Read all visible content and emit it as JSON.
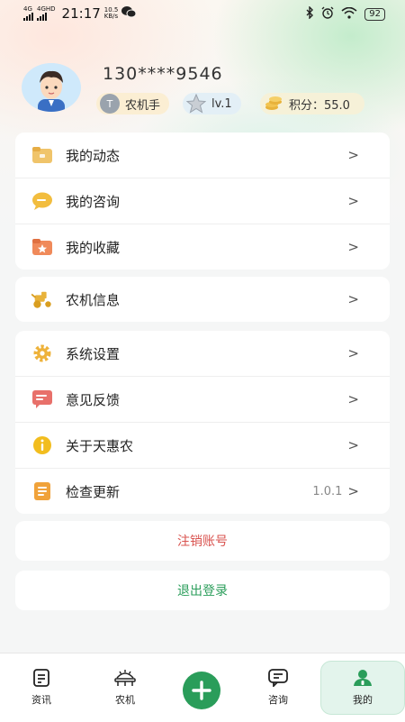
{
  "status_bar": {
    "signal_1": "4G",
    "signal_2": "4GHD",
    "time": "21:17",
    "speed_value": "10.5",
    "speed_unit": "KB/s",
    "battery": "92"
  },
  "profile": {
    "phone": "130****9546",
    "role_badge": "农机手",
    "level_badge": "lv.1",
    "points_badge": "积分：55.0"
  },
  "menu_group_1": [
    {
      "label": "我的动态",
      "icon": "folder-icon"
    },
    {
      "label": "我的咨询",
      "icon": "chat-bubble-icon"
    },
    {
      "label": "我的收藏",
      "icon": "star-folder-icon"
    }
  ],
  "menu_group_2": [
    {
      "label": "农机信息",
      "icon": "tractor-icon"
    }
  ],
  "menu_group_3": [
    {
      "label": "系统设置",
      "icon": "gear-icon"
    },
    {
      "label": "意见反馈",
      "icon": "feedback-icon"
    },
    {
      "label": "关于天惠农",
      "icon": "info-icon"
    },
    {
      "label": "检查更新",
      "icon": "update-icon",
      "value": "1.0.1"
    }
  ],
  "chevron": ">",
  "deactivate_label": "注销账号",
  "logout_label": "退出登录",
  "tabs": [
    {
      "label": "资讯",
      "icon": "news-icon"
    },
    {
      "label": "农机",
      "icon": "machine-icon"
    },
    {
      "label": "咨询",
      "icon": "consult-icon"
    },
    {
      "label": "我的",
      "icon": "profile-icon"
    }
  ],
  "colors": {
    "accent_green": "#2a9d5a",
    "deactivate_red": "#d9534f",
    "logout_green": "#2a9d5a",
    "tab_active_bg": "#e3f4ec"
  }
}
